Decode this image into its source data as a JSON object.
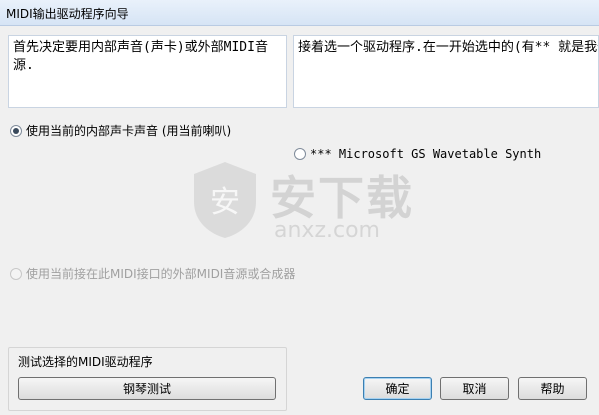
{
  "window": {
    "title": "MIDI输出驱动程序向导"
  },
  "info": {
    "left_text": "首先决定要用内部声音(声卡)或外部MIDI音源.",
    "right_text": "接着选一个驱动程序.在一开始选中的(有**\n就是我们建议的."
  },
  "options": {
    "internal": {
      "label": "使用当前的内部声卡声音 (用当前喇叭)",
      "selected": true
    },
    "driver": {
      "label": "*** Microsoft GS Wavetable Synth",
      "selected": false
    },
    "external": {
      "label": "使用当前接在此MIDI接口的外部MIDI音源或合成器",
      "enabled": false
    }
  },
  "watermark": {
    "text_cn": "安下载",
    "text_en": "anxz.com",
    "badge": "安"
  },
  "test_group": {
    "label": "测试选择的MIDI驱动程序",
    "piano_button": "钢琴测试"
  },
  "buttons": {
    "ok": "确定",
    "cancel": "取消",
    "help": "帮助"
  }
}
